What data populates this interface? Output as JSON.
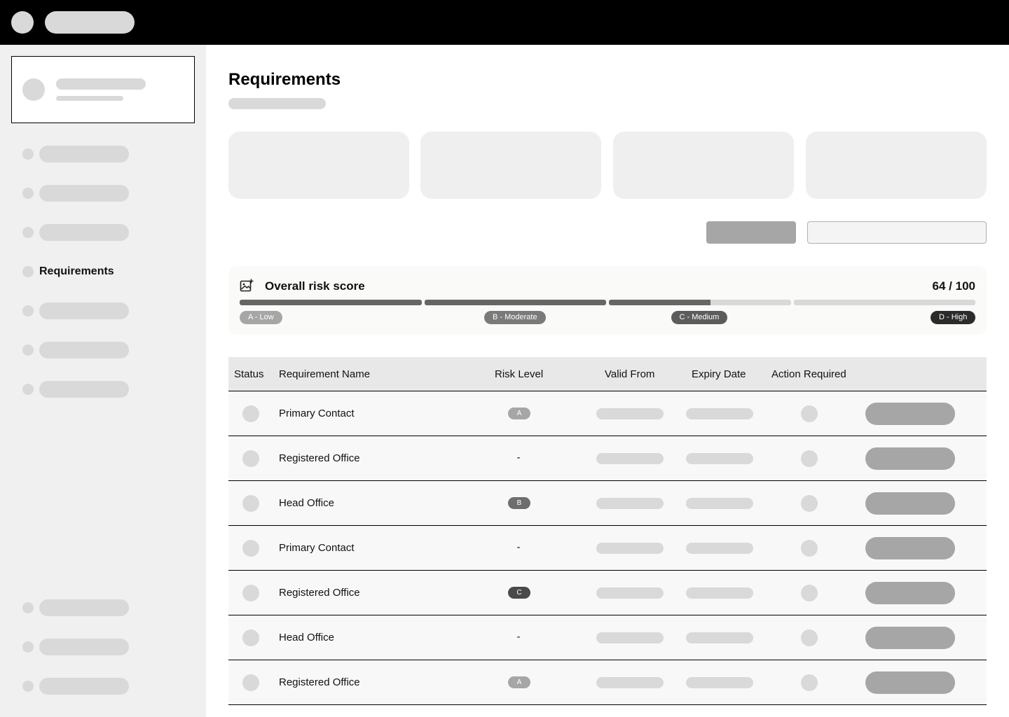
{
  "sidebar": {
    "active_item_label": "Requirements"
  },
  "main": {
    "page_title": "Requirements"
  },
  "risk_score": {
    "title": "Overall risk score",
    "score_text": "64 / 100",
    "score_value": 64,
    "score_max": 100,
    "icon": "image-add-icon",
    "bands": [
      {
        "label": "A - Low",
        "color": "#a6a6a6"
      },
      {
        "label": "B - Moderate",
        "color": "#7a7a7a"
      },
      {
        "label": "C - Medium",
        "color": "#5c5c5c"
      },
      {
        "label": "D - High",
        "color": "#2b2b2b"
      }
    ]
  },
  "table": {
    "headers": {
      "status": "Status",
      "name": "Requirement Name",
      "risk": "Risk Level",
      "valid_from": "Valid From",
      "expiry": "Expiry Date",
      "action": "Action Required"
    },
    "rows": [
      {
        "name": "Primary Contact",
        "risk": "A"
      },
      {
        "name": "Registered Office",
        "risk": "-"
      },
      {
        "name": "Head Office",
        "risk": "B"
      },
      {
        "name": "Primary Contact",
        "risk": "-"
      },
      {
        "name": "Registered Office",
        "risk": "C"
      },
      {
        "name": "Head Office",
        "risk": "-"
      },
      {
        "name": "Registered Office",
        "risk": "A"
      }
    ]
  },
  "colors": {
    "risk_A": "#a6a6a6",
    "risk_B": "#6e6e6e",
    "risk_C": "#4a4a4a"
  }
}
